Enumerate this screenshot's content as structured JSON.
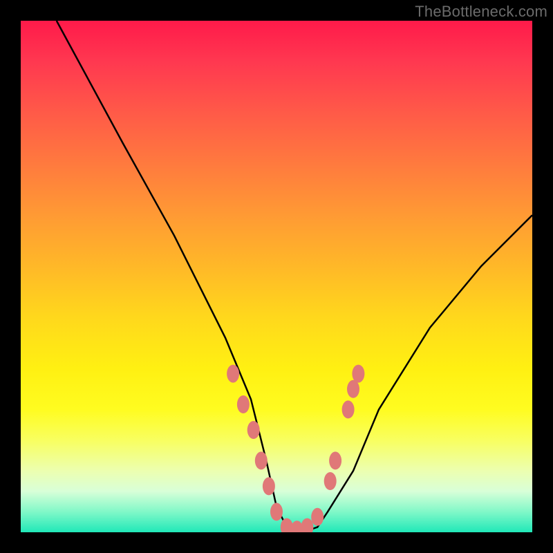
{
  "watermark": "TheBottleneck.com",
  "chart_data": {
    "type": "line",
    "title": "",
    "xlabel": "",
    "ylabel": "",
    "xlim": [
      0,
      100
    ],
    "ylim": [
      0,
      100
    ],
    "series": [
      {
        "name": "curve",
        "x": [
          7,
          20,
          30,
          40,
          45,
          48,
          50,
          52,
          55,
          58,
          60,
          65,
          70,
          80,
          90,
          100
        ],
        "y": [
          100,
          76,
          58,
          38,
          26,
          14,
          5,
          1,
          0,
          1,
          4,
          12,
          24,
          40,
          52,
          62
        ]
      }
    ],
    "markers": [
      {
        "x": 41.5,
        "y": 31
      },
      {
        "x": 43.5,
        "y": 25
      },
      {
        "x": 45.5,
        "y": 20
      },
      {
        "x": 47,
        "y": 14
      },
      {
        "x": 48.5,
        "y": 9
      },
      {
        "x": 50,
        "y": 4
      },
      {
        "x": 52,
        "y": 1
      },
      {
        "x": 54,
        "y": 0.5
      },
      {
        "x": 56,
        "y": 1
      },
      {
        "x": 58,
        "y": 3
      },
      {
        "x": 60.5,
        "y": 10
      },
      {
        "x": 61.5,
        "y": 14
      },
      {
        "x": 64,
        "y": 24
      },
      {
        "x": 65,
        "y": 28
      },
      {
        "x": 66,
        "y": 31
      }
    ],
    "colors": {
      "curve": "#000000",
      "marker_fill": "#e07878",
      "marker_stroke": "#c05858"
    }
  }
}
